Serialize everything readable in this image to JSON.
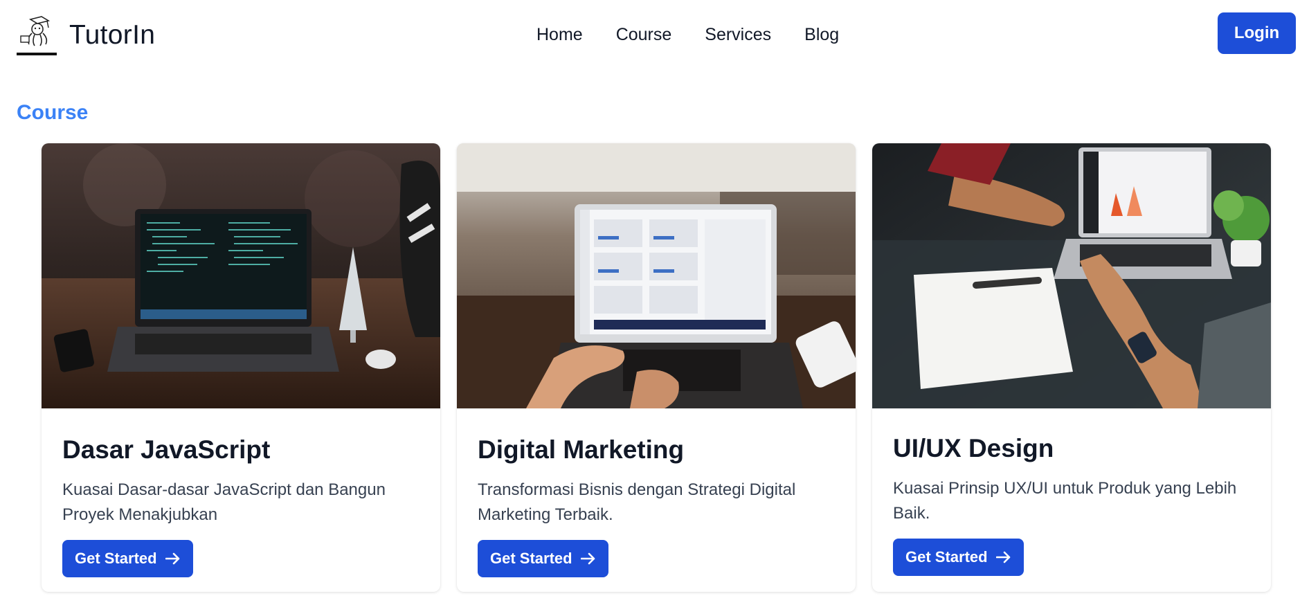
{
  "brand": {
    "name": "TutorIn",
    "logo_icon": "graduation-mascot-icon"
  },
  "nav": {
    "links": [
      "Home",
      "Course",
      "Services",
      "Blog"
    ],
    "login_label": "Login"
  },
  "section": {
    "title": "Course"
  },
  "courses": [
    {
      "title": "Dasar JavaScript",
      "description": "Kuasai Dasar-dasar JavaScript dan Bangun Proyek Menakjubkan",
      "cta_label": "Get Started",
      "image_icon": "laptop-code-photo"
    },
    {
      "title": "Digital Marketing",
      "description": "Transformasi Bisnis dengan Strategi Digital Marketing Terbaik.",
      "cta_label": "Get Started",
      "image_icon": "laptop-dashboard-photo"
    },
    {
      "title": "UI/UX Design",
      "description": "Kuasai Prinsip UX/UI untuk Produk yang Lebih Baik.",
      "cta_label": "Get Started",
      "image_icon": "laptop-design-photo"
    }
  ],
  "colors": {
    "primary": "#1d4ed8",
    "accent": "#3b82f6",
    "text": "#111827",
    "muted": "#374151"
  }
}
